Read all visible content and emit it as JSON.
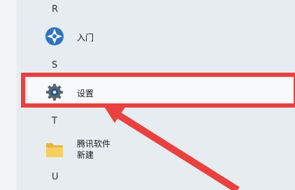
{
  "start_menu": {
    "groups": [
      {
        "letter": "R",
        "apps": [
          {
            "label": "入门",
            "icon": "get-started-icon"
          }
        ]
      },
      {
        "letter": "S",
        "apps": [
          {
            "label": "设置",
            "icon": "gear-icon"
          }
        ]
      },
      {
        "letter": "T",
        "apps": [
          {
            "label": "腾讯软件",
            "label2": "新建",
            "icon": "folder-icon"
          }
        ]
      },
      {
        "letter": "U",
        "apps": []
      }
    ]
  },
  "colors": {
    "highlight": "#e8413f",
    "background": "#e6ecef",
    "folder": "#f3c14a",
    "get_started": "#2f74c0"
  }
}
